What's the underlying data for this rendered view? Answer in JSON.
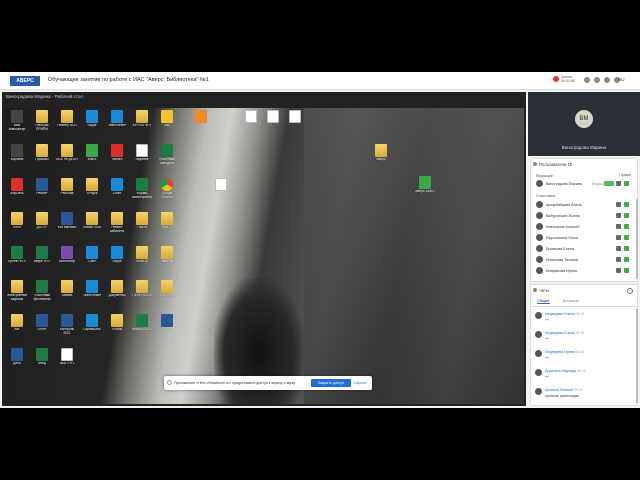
{
  "header": {
    "logo": "АВЕРС",
    "title": "Обучающее занятие по работе с ИАС \"Аверс: Библиотека\" №1",
    "record_label": "Запись",
    "record_time": "00:02:58",
    "lang": "RU"
  },
  "stage": {
    "title": "Виноградова Марина - Рабочий стол"
  },
  "desktop_icons": [
    {
      "label": "Мой компьютер",
      "type": "dark"
    },
    {
      "label": "Рабочая ПРИЁМ",
      "type": "folder"
    },
    {
      "label": "Планер 2021",
      "type": "folder"
    },
    {
      "label": "Skype",
      "type": "blue"
    },
    {
      "label": "TeamViewer",
      "type": "blue"
    },
    {
      "label": "КУРСЫ ФГУ",
      "type": "folder"
    },
    {
      "label": "ЧВК",
      "type": "yellow"
    },
    {
      "label": "Корзина",
      "type": "dark"
    },
    {
      "label": "Приказы",
      "type": "folder"
    },
    {
      "label": "ВСЁ НЕДЕЛЯ",
      "type": "folder"
    },
    {
      "label": "Книги",
      "type": "green"
    },
    {
      "label": "Yandex",
      "type": "red"
    },
    {
      "label": "Задание",
      "type": "doc"
    },
    {
      "label": "Участники конкурса",
      "type": "excel"
    },
    {
      "label": "AnyDesk",
      "type": "red"
    },
    {
      "label": "Ремонт",
      "type": "word"
    },
    {
      "label": "Рабочая",
      "type": "folder"
    },
    {
      "label": "Отпуск",
      "type": "folder"
    },
    {
      "label": "Zoom",
      "type": "blue"
    },
    {
      "label": "Формы мониторинга",
      "type": "excel"
    },
    {
      "label": "Google Chrome",
      "type": "chrome"
    },
    {
      "label": "Фото",
      "type": "folder"
    },
    {
      "label": "ДОСУГ",
      "type": "folder"
    },
    {
      "label": "Кто виноват",
      "type": "word"
    },
    {
      "label": "Планы 2020",
      "type": "folder"
    },
    {
      "label": "Ремонт кабинета",
      "type": "folder"
    },
    {
      "label": "Почта",
      "type": "folder"
    },
    {
      "label": "КМГП",
      "type": "folder"
    },
    {
      "label": "Проект ФТУ",
      "type": "excel"
    },
    {
      "label": "Аверс ФТУ",
      "type": "excel"
    },
    {
      "label": "Кинотеатр",
      "type": "purple"
    },
    {
      "label": "Сайт",
      "type": "blue"
    },
    {
      "label": "Skype",
      "type": "blue"
    },
    {
      "label": "НОВОЕ",
      "type": "folder"
    },
    {
      "label": "Занятия",
      "type": "folder"
    },
    {
      "label": "Электронные издания",
      "type": "folder"
    },
    {
      "label": "Участники фестиваля",
      "type": "excel"
    },
    {
      "label": "Заявка",
      "type": "folder"
    },
    {
      "label": "TeamViewer",
      "type": "blue"
    },
    {
      "label": "Документы",
      "type": "folder"
    },
    {
      "label": "ПЕРЕНОСЫ",
      "type": "folder"
    },
    {
      "label": "ТОП 2021",
      "type": "folder"
    },
    {
      "label": "Акт",
      "type": "folder"
    },
    {
      "label": "Отчет",
      "type": "word"
    },
    {
      "label": "Контроль 2021",
      "type": "word"
    },
    {
      "label": "Скриншоты",
      "type": "blue"
    },
    {
      "label": "Планы",
      "type": "folder"
    },
    {
      "label": "Книга 8-2021",
      "type": "excel"
    },
    {
      "label": "Отчет",
      "type": "word"
    },
    {
      "label": "Дело",
      "type": "word"
    },
    {
      "label": "Фонд",
      "type": "excel"
    },
    {
      "label": "ВЫСТУП",
      "type": "doc"
    }
  ],
  "desktop_icons_right": [
    {
      "label": "",
      "type": "orange"
    },
    {
      "label": "",
      "type": "doc"
    },
    {
      "label": "",
      "type": "doc"
    },
    {
      "label": "",
      "type": "doc"
    },
    {
      "label": "",
      "type": "doc"
    },
    {
      "label": "Аверс",
      "type": "folder"
    },
    {
      "label": "Аверс АБИС",
      "type": "green"
    }
  ],
  "notice": {
    "text": "Приложение «Html.Virtualroom.ru» предоставило доступ к экрану и звуку.",
    "button": "Закрыть доступ",
    "hide": "Скрыть"
  },
  "webcam": {
    "initials": "ВМ",
    "name": "Виноградова Марина"
  },
  "participants": {
    "header": "Пользователи 19",
    "leaders_label": "Ведущие",
    "leaders_action": "Правка",
    "leaders": [
      {
        "name": "Виноградова Марина",
        "status": "Ведущий"
      }
    ],
    "members_label": "Участники",
    "members": [
      {
        "name": "Архарбайцева Алена"
      },
      {
        "name": "Бабуровская Жанна"
      },
      {
        "name": "Емельянов Алексей"
      },
      {
        "name": "Ефросинина Ольга"
      },
      {
        "name": "Ермакова Елена"
      },
      {
        "name": "Иглинская Татьяна"
      },
      {
        "name": "Епифанова Ирина"
      }
    ]
  },
  "chat": {
    "header": "Чаты",
    "tabs": [
      "Общий",
      "Вопросы"
    ],
    "messages": [
      {
        "name": "Медведева Елена",
        "time": "09:14",
        "text": "++"
      },
      {
        "name": "Медведева Елена",
        "time": "09:15",
        "text": "++"
      },
      {
        "name": "Медведева Ирина",
        "time": "09:15",
        "text": "++"
      },
      {
        "name": "Курилина Надежда",
        "time": "09:22",
        "text": "++"
      },
      {
        "name": "Архипов Евгений",
        "time": "09:25",
        "text": "пропала трансляция"
      }
    ]
  }
}
